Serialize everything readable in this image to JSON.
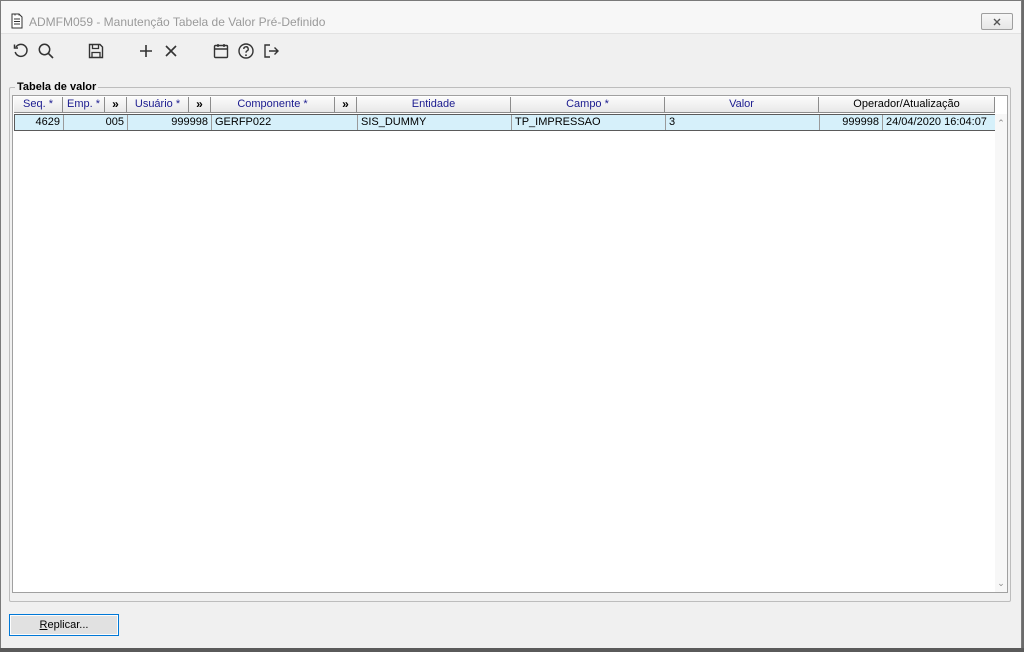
{
  "window": {
    "title": "ADMFM059 - Manutenção Tabela de Valor Pré-Definido"
  },
  "toolbar": {
    "icons": [
      "refresh-icon",
      "search-icon",
      "save-icon",
      "add-icon",
      "delete-icon",
      "calendar-icon",
      "help-icon",
      "exit-icon"
    ]
  },
  "group": {
    "label": "Tabela de valor"
  },
  "grid": {
    "columns": [
      {
        "label": "Seq. *"
      },
      {
        "label": "Emp. *"
      },
      {
        "label": "»"
      },
      {
        "label": "Usuário *"
      },
      {
        "label": "»"
      },
      {
        "label": "Componente *"
      },
      {
        "label": "»"
      },
      {
        "label": "Entidade"
      },
      {
        "label": "Campo *"
      },
      {
        "label": "Valor"
      },
      {
        "label": "Operador/Atualização"
      }
    ],
    "rows": [
      {
        "seq": "4629",
        "emp": "005",
        "usuario": "999998",
        "componente": "GERFP022",
        "entidade": "SIS_DUMMY",
        "campo": "TP_IMPRESSAO",
        "valor": "3",
        "operador": "999998",
        "atualizacao": "24/04/2020 16:04:07"
      }
    ]
  },
  "buttons": {
    "replicar_first": "R",
    "replicar_rest": "eplicar..."
  },
  "colors": {
    "selected_row": "#d6f0fa",
    "header_text": "#1b1b8f",
    "focus_border": "#0078d7"
  }
}
